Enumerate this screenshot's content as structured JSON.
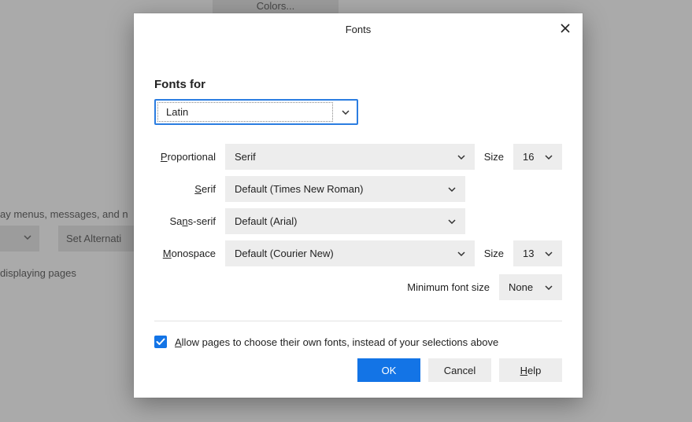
{
  "bg": {
    "colors_btn": "Colors...",
    "text1": "ay menus, messages, and n",
    "alt_btn": "Set Alternati",
    "text2": "displaying pages"
  },
  "dialog": {
    "title": "Fonts",
    "fonts_for_label": "Fonts for",
    "fonts_for_value": "Latin",
    "rows": {
      "proportional": {
        "label_pre": "P",
        "label_rest": "roportional",
        "value": "Serif",
        "size_label": "Size",
        "size_value": "16"
      },
      "serif": {
        "label_pre": "S",
        "label_rest": "erif",
        "value": "Default (Times New Roman)"
      },
      "sans": {
        "label_pre": "Sa",
        "label_mid_u": "n",
        "label_post": "s-serif",
        "value": "Default (Arial)"
      },
      "mono": {
        "label_pre": "M",
        "label_rest": "onospace",
        "value": "Default (Courier New)",
        "size_label": "Size",
        "size_value": "13"
      }
    },
    "min_size": {
      "label_pre": "Minimum f",
      "label_mid_u": "o",
      "label_post": "nt size",
      "value": "None"
    },
    "checkbox": {
      "pre": "A",
      "rest": "llow pages to choose their own fonts, instead of your selections above",
      "checked": true
    },
    "buttons": {
      "ok": "OK",
      "cancel": "Cancel",
      "help_pre": "H",
      "help_rest": "elp"
    }
  }
}
